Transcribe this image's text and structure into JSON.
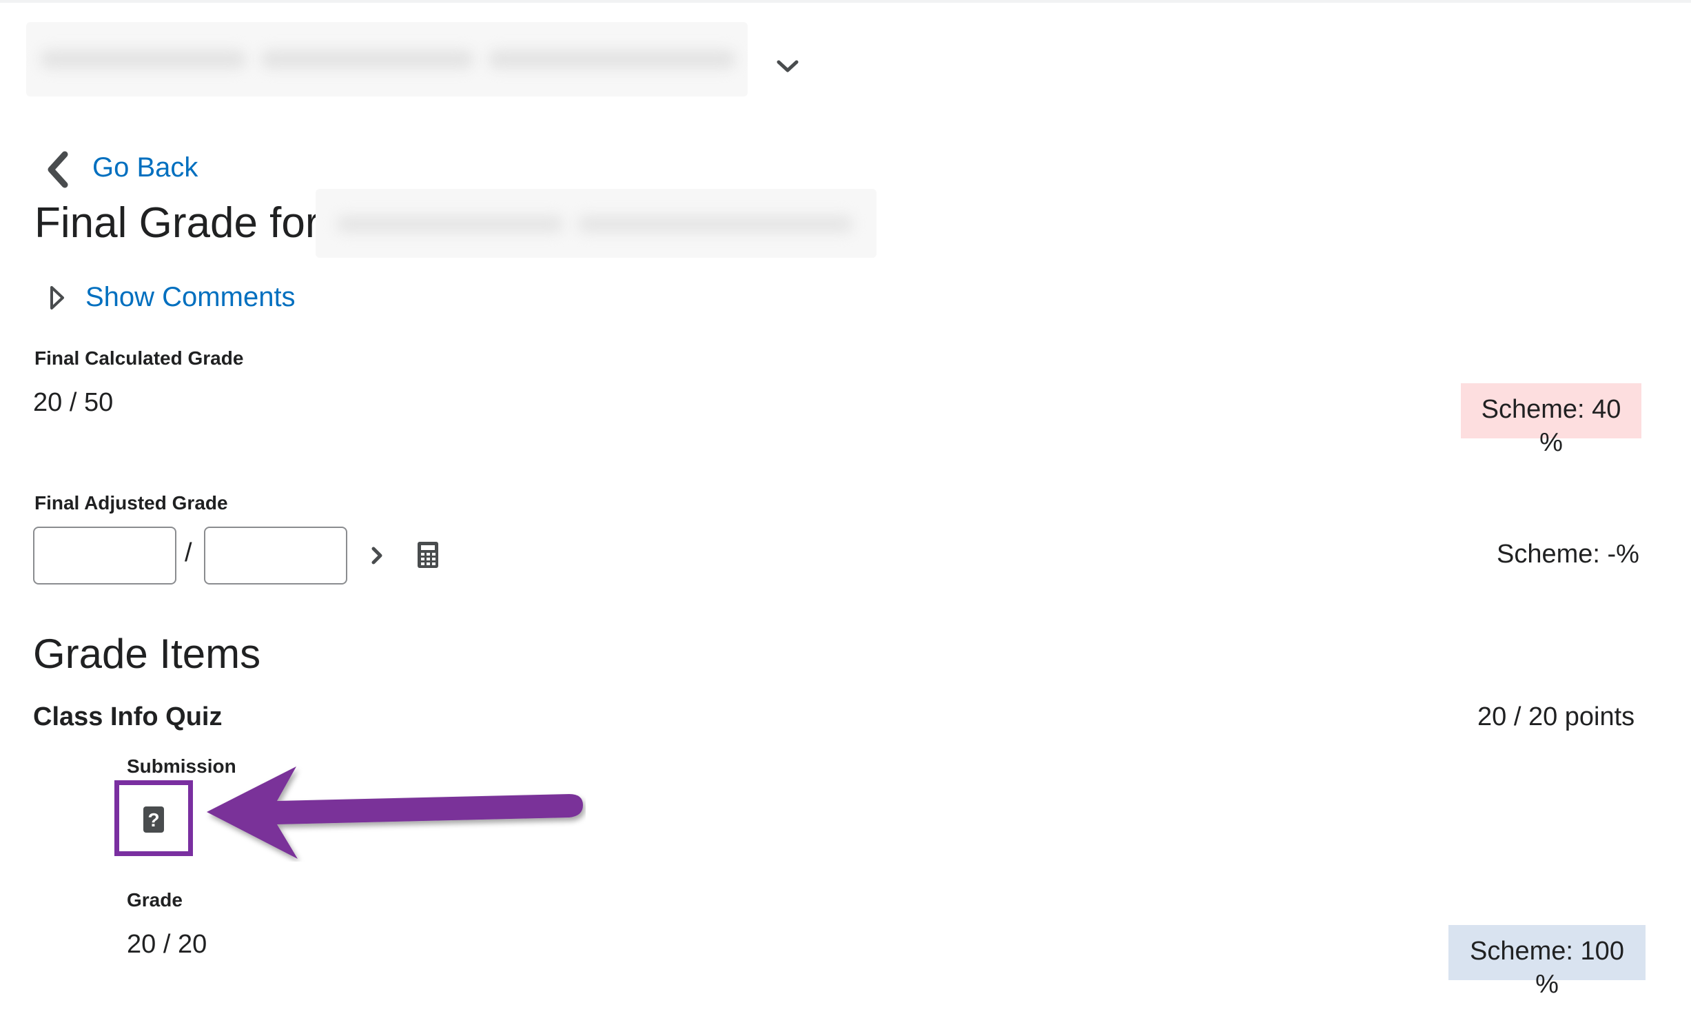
{
  "nav": {
    "back_label": "Go Back"
  },
  "page": {
    "title": "Final Grade for"
  },
  "comments": {
    "toggle_label": "Show Comments"
  },
  "final_calculated": {
    "label": "Final Calculated Grade",
    "value": "20 / 50",
    "scheme": "Scheme: 40 %",
    "scheme_color": "#fddedf"
  },
  "final_adjusted": {
    "label": "Final Adjusted Grade",
    "numerator_value": "",
    "denominator_value": "",
    "separator": "/",
    "scheme": "Scheme: -%"
  },
  "grade_items": {
    "section_title": "Grade Items",
    "items": [
      {
        "title": "Class Info Quiz",
        "points": "20 / 20 points",
        "submission_label": "Submission",
        "submission_icon": "question-mark-icon",
        "grade_label": "Grade",
        "grade_value": "20 / 20",
        "scheme": "Scheme: 100 %",
        "scheme_color": "#d9e3f0"
      }
    ]
  },
  "colors": {
    "link": "#006fbf",
    "highlight": "#7a2fa0",
    "text": "#202122"
  }
}
